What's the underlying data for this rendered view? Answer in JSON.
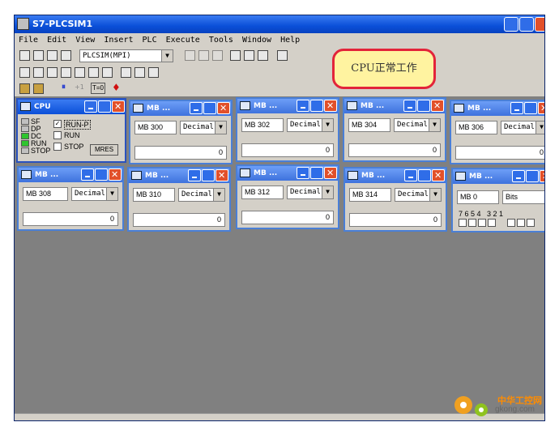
{
  "app": {
    "title": "S7-PLCSIM1"
  },
  "menu": [
    "File",
    "Edit",
    "View",
    "Insert",
    "PLC",
    "Execute",
    "Tools",
    "Window",
    "Help"
  ],
  "toolbar": {
    "connection": "PLCSIM(MPI)",
    "rung_label_1": "T=0"
  },
  "callout": "CPU正常工作",
  "cpu": {
    "title": "CPU",
    "leds": [
      "SF",
      "DP",
      "DC",
      "RUN",
      "STOP"
    ],
    "run_p": "RUN-P",
    "run": "RUN",
    "stop": "STOP",
    "mres": "MRES"
  },
  "mb_windows": [
    {
      "title": "MB ...",
      "address": "MB  300",
      "format": "Decimal",
      "value": "0"
    },
    {
      "title": "MB ...",
      "address": "MB  302",
      "format": "Decimal",
      "value": "0"
    },
    {
      "title": "MB ...",
      "address": "MB  304",
      "format": "Decimal",
      "value": "0"
    },
    {
      "title": "MB ...",
      "address": "MB  306",
      "format": "Decimal",
      "value": "0"
    },
    {
      "title": "MB ...",
      "address": "MB  308",
      "format": "Decimal",
      "value": "0"
    },
    {
      "title": "MB ...",
      "address": "MB  310",
      "format": "Decimal",
      "value": "0"
    },
    {
      "title": "MB ...",
      "address": "MB  312",
      "format": "Decimal",
      "value": "0"
    },
    {
      "title": "MB ...",
      "address": "MB  314",
      "format": "Decimal",
      "value": "0"
    }
  ],
  "bits_window": {
    "title": "MB ...",
    "address": "MB   0",
    "format": "Bits",
    "bits_label": "7 6 5 4   3 2 1"
  },
  "watermark": {
    "name": "中华工控网",
    "url": "gkong.com"
  }
}
